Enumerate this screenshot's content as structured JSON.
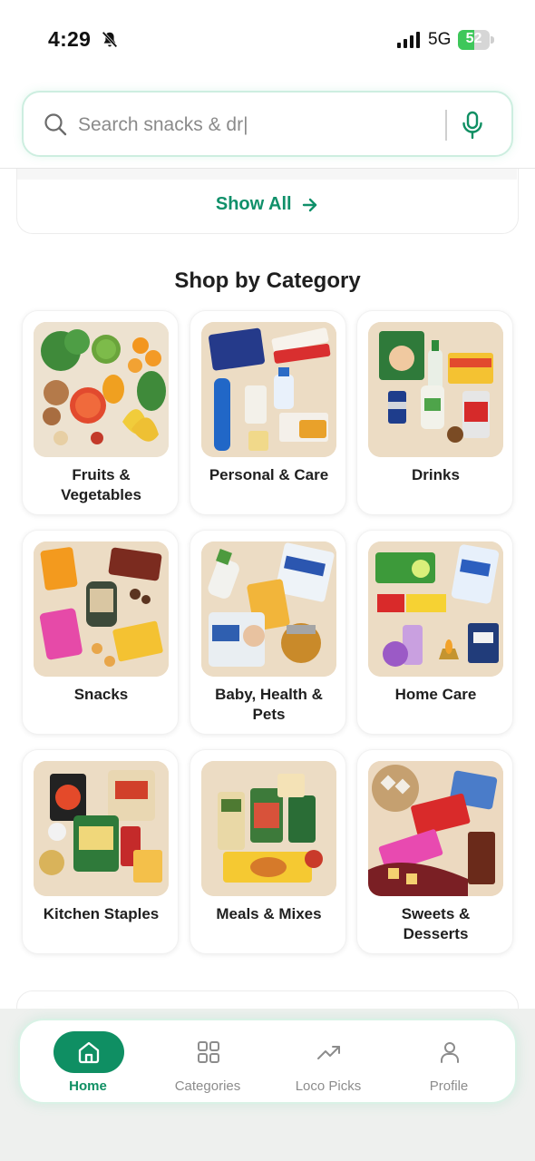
{
  "status_bar": {
    "time": "4:29",
    "network": "5G",
    "battery": 52
  },
  "search": {
    "placeholder": "Search snacks & dr|"
  },
  "show_all": {
    "label": "Show All"
  },
  "section": {
    "title": "Shop by Category"
  },
  "categories": [
    {
      "label": "Fruits &\nVegetables",
      "icon": "fruits-vegetables-image"
    },
    {
      "label": "Personal & Care",
      "icon": "personal-care-image"
    },
    {
      "label": "Drinks",
      "icon": "drinks-image"
    },
    {
      "label": "Snacks",
      "icon": "snacks-image"
    },
    {
      "label": "Baby, Health &\nPets",
      "icon": "baby-health-pets-image"
    },
    {
      "label": "Home Care",
      "icon": "home-care-image"
    },
    {
      "label": "Kitchen Staples",
      "icon": "kitchen-staples-image"
    },
    {
      "label": "Meals & Mixes",
      "icon": "meals-mixes-image"
    },
    {
      "label": "Sweets &\nDesserts",
      "icon": "sweets-desserts-image"
    }
  ],
  "bottom_nav": [
    {
      "label": "Home",
      "icon": "home-icon",
      "active": true
    },
    {
      "label": "Categories",
      "icon": "grid-icon",
      "active": false
    },
    {
      "label": "Loco Picks",
      "icon": "trending-icon",
      "active": false
    },
    {
      "label": "Profile",
      "icon": "user-icon",
      "active": false
    }
  ],
  "colors": {
    "accent": "#0f8f63",
    "card_bg": "#ecdcc4",
    "battery": "#3ec75a"
  }
}
